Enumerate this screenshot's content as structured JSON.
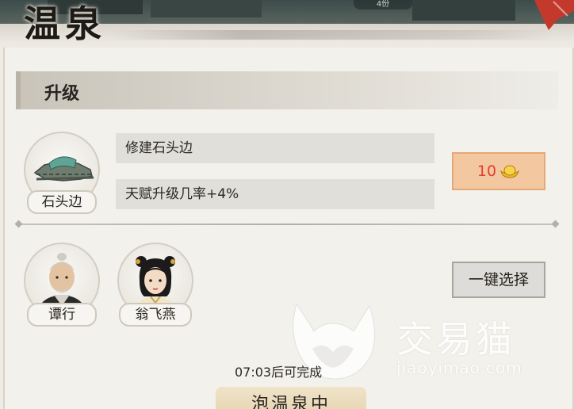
{
  "header": {
    "title": "温泉",
    "top_time_tag": "4份"
  },
  "upgrade": {
    "section_title": "升级",
    "item": {
      "name": "石头边",
      "action_text": "修建石头边",
      "effect_text": "天赋升级几率+4%",
      "cost_amount": "10",
      "cost_icon": "gold-ingot-icon"
    }
  },
  "characters": [
    {
      "name": "谭行",
      "icon": "old-man-portrait"
    },
    {
      "name": "翁飞燕",
      "icon": "young-woman-portrait"
    }
  ],
  "one_click_select_label": "一键选择",
  "timer_text": "07:03后可完成",
  "bottom_button_label": "泡温泉中",
  "watermark": {
    "brand": "交易猫",
    "url": "jiaoyimao.com"
  },
  "colors": {
    "cost_number": "#e0402e",
    "cost_button_bg": "#f3c8a0",
    "panel_bg": "#f3f1ec"
  }
}
